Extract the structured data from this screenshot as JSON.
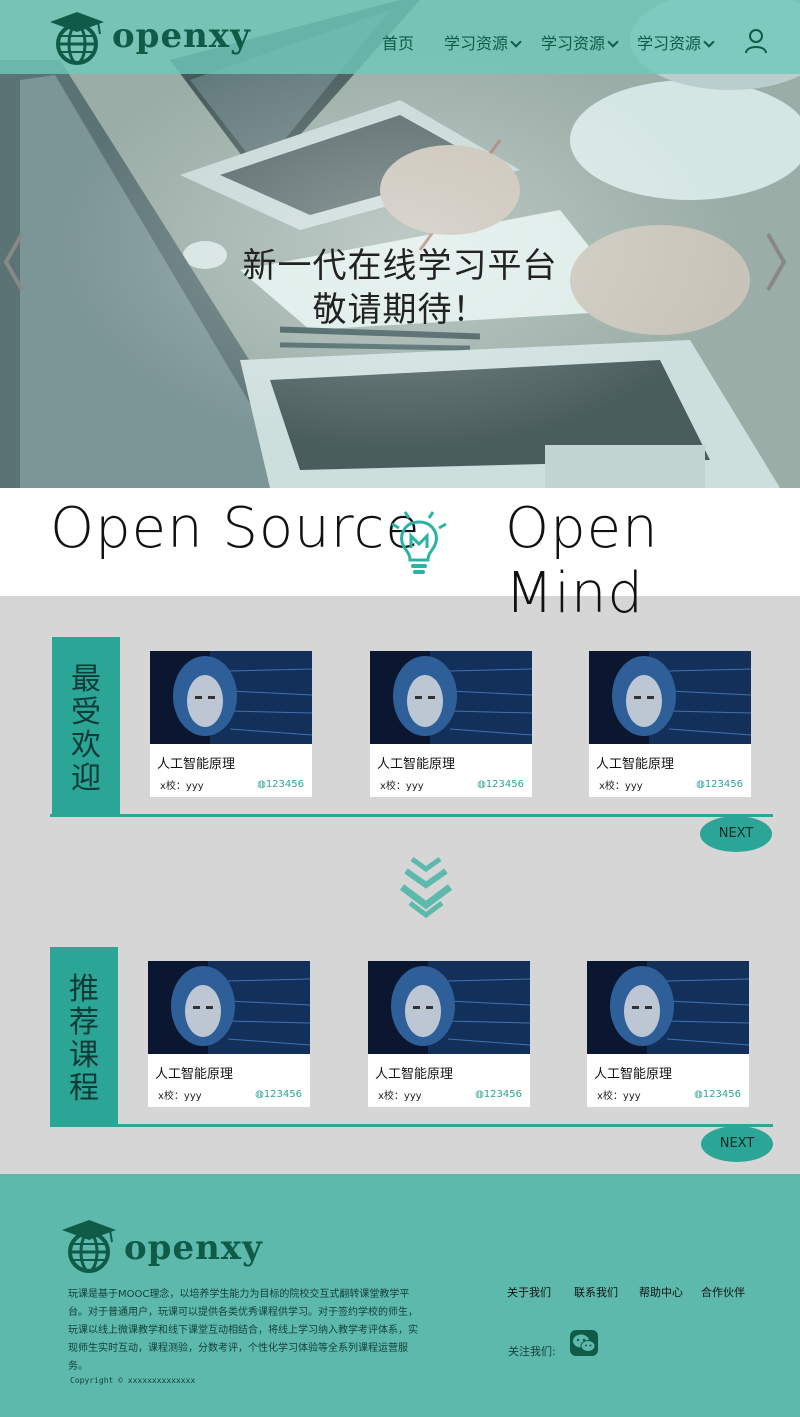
{
  "brand": {
    "name": "openxy"
  },
  "nav": {
    "items": [
      {
        "label": "首页",
        "has_dropdown": false
      },
      {
        "label": "学习资源",
        "has_dropdown": true
      },
      {
        "label": "学习资源",
        "has_dropdown": true
      },
      {
        "label": "学习资源",
        "has_dropdown": true
      }
    ],
    "user_icon": "user-icon"
  },
  "hero": {
    "line1": "新一代在线学习平台",
    "line2": "敬请期待！"
  },
  "band": {
    "left": "Open Source",
    "right": "Open Mind",
    "icon": "lightbulb-m-icon"
  },
  "sections": [
    {
      "label": [
        "最",
        "受",
        "欢",
        "迎"
      ],
      "next_label": "NEXT",
      "courses": [
        {
          "title": "人工智能原理",
          "school": "x校：yyy",
          "count": "123456"
        },
        {
          "title": "人工智能原理",
          "school": "x校：yyy",
          "count": "123456"
        },
        {
          "title": "人工智能原理",
          "school": "x校：yyy",
          "count": "123456"
        }
      ]
    },
    {
      "label": [
        "推",
        "荐",
        "课",
        "程"
      ],
      "next_label": "NEXT",
      "courses": [
        {
          "title": "人工智能原理",
          "school": "x校：yyy",
          "count": "123456"
        },
        {
          "title": "人工智能原理",
          "school": "x校：yyy",
          "count": "123456"
        },
        {
          "title": "人工智能原理",
          "school": "x校：yyy",
          "count": "123456"
        }
      ]
    }
  ],
  "footer": {
    "description": "玩课是基于MOOC理念，以培养学生能力为目标的院校交互式翻转课堂教学平台。对于普通用户，玩课可以提供各类优秀课程供学习。对于签约学校的师生，玩课以线上微课教学和线下课堂互动相结合，将线上学习纳入教学考评体系，实现师生实时互动，课程测验，分数考评，个性化学习体验等全系列课程运营服务。",
    "copyright": "Copyright © xxxxxxxxxxxxxx",
    "links": [
      "关于我们",
      "联系我们",
      "帮助中心",
      "合作伙伴"
    ],
    "follow_label": "关注我们:",
    "social_icon": "wechat-icon"
  },
  "colors": {
    "teal": "#2aa596",
    "header": "#6ec9ba",
    "footer": "#5cb9ab",
    "dark_green": "#0f5b47",
    "section_bg": "#d6d6d6"
  }
}
